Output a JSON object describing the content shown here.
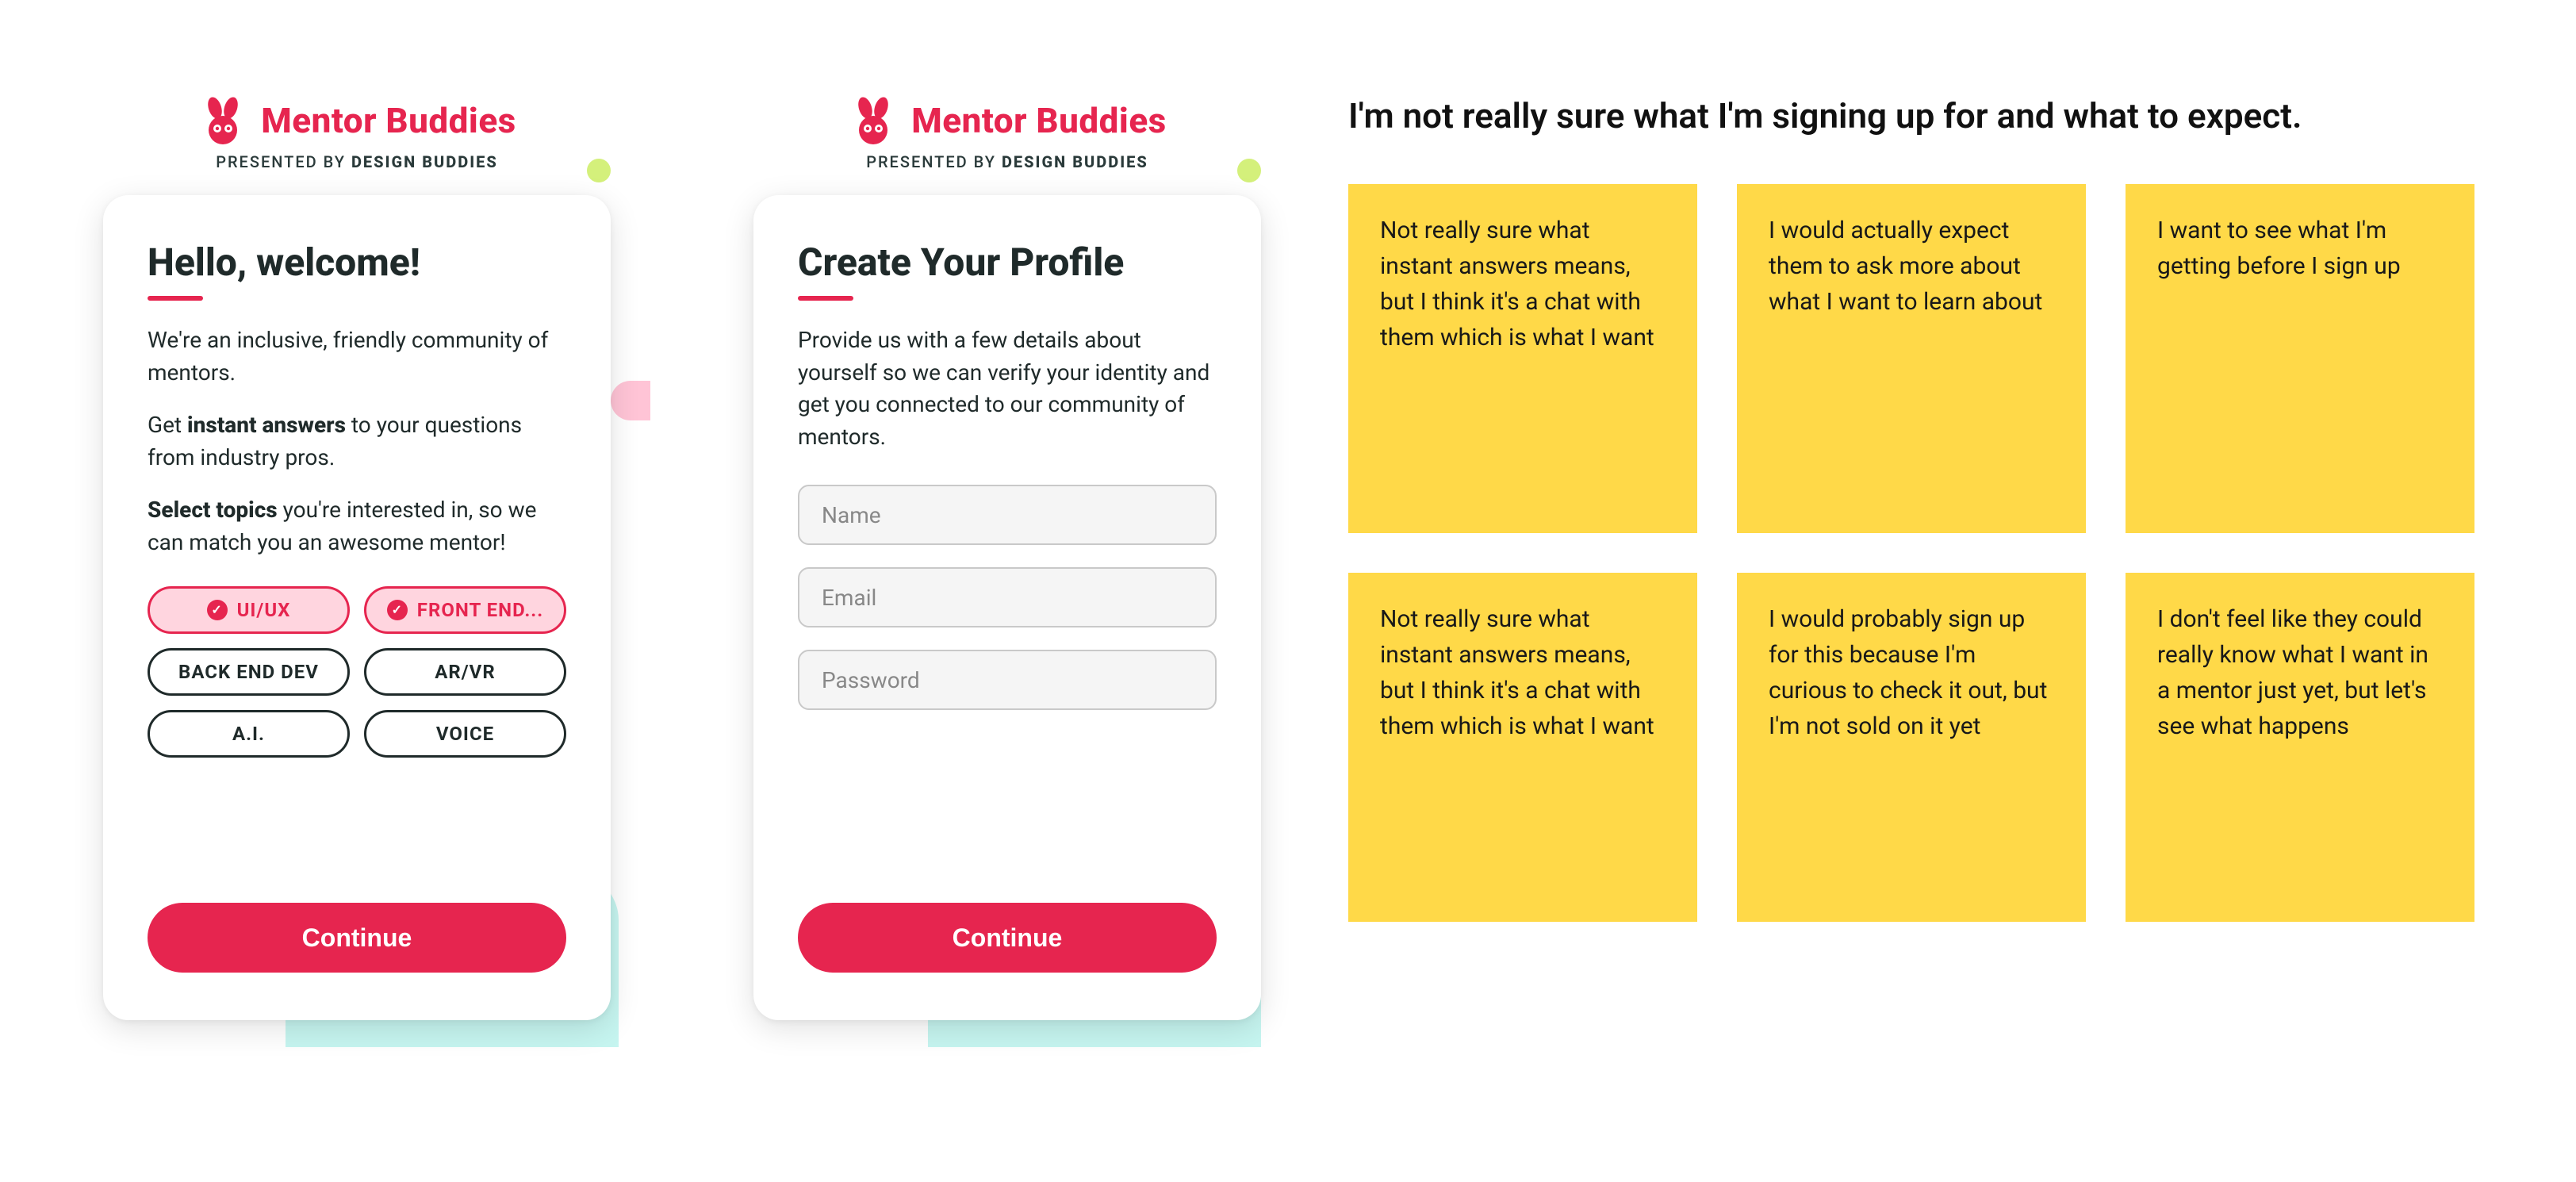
{
  "brand": {
    "name": "Mentor Buddies",
    "presented_prefix": "PRESENTED BY ",
    "presented_bold": "DESIGN BUDDIES"
  },
  "welcome": {
    "title": "Hello, welcome!",
    "p1": "We're an inclusive, friendly community of mentors.",
    "p2_pre": "Get ",
    "p2_bold": "instant answers",
    "p2_post": " to your questions from industry pros.",
    "p3_bold": "Select topics",
    "p3_post": " you're interested in, so we can match you an awesome mentor!",
    "topics": [
      {
        "label": "UI/UX",
        "selected": true
      },
      {
        "label": "FRONT END...",
        "selected": true
      },
      {
        "label": "BACK END DEV",
        "selected": false
      },
      {
        "label": "AR/VR",
        "selected": false
      },
      {
        "label": "A.I.",
        "selected": false
      },
      {
        "label": "VOICE",
        "selected": false
      }
    ],
    "cta": "Continue"
  },
  "profile": {
    "title": "Create Your Profile",
    "desc": "Provide us with a few details about yourself so we can verify your identity and get you connected to our community of mentors.",
    "fields": {
      "name": "Name",
      "email": "Email",
      "password": "Password"
    },
    "cta": "Continue"
  },
  "feedback": {
    "heading": "I'm not really sure what I'm signing up for and what to expect.",
    "notes": [
      "Not really sure what instant answers means, but I think it's a chat with them which is what I want",
      "I would actually expect them to ask more about what I want to learn about",
      "I want to see what I'm getting before I sign up",
      "Not really sure what instant answers means, but I think it's a chat with them which is what I want",
      "I would probably sign up for this because I'm curious to check it out, but I'm not sold on it yet",
      "I don't feel like they could really know what I want in a mentor just yet, but let's see what happens"
    ]
  }
}
